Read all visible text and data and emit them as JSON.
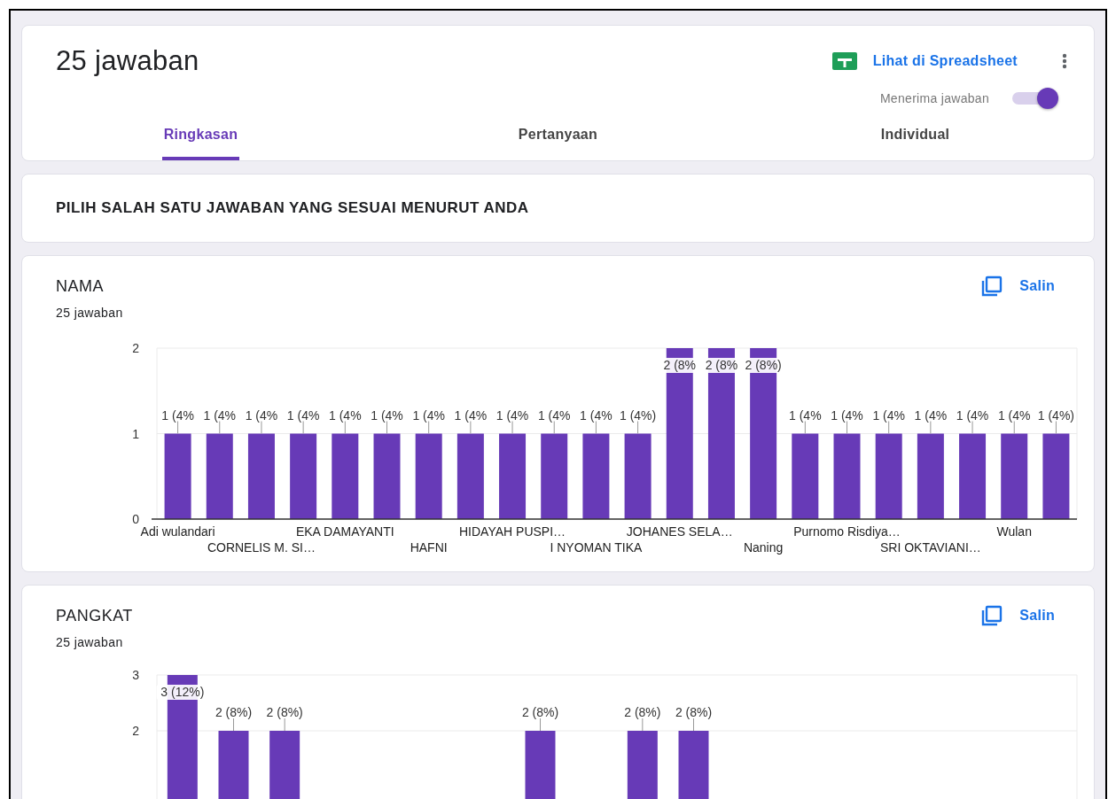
{
  "header": {
    "title": "25 jawaban",
    "spreadsheet_link": "Lihat di Spreadsheet",
    "accepting": {
      "label": "Menerima jawaban",
      "on": true
    }
  },
  "tabs": [
    {
      "label": "Ringkasan",
      "selected": true
    },
    {
      "label": "Pertanyaan",
      "selected": false
    },
    {
      "label": "Individual",
      "selected": false
    }
  ],
  "section": {
    "title": "PILIH SALAH SATU JAWABAN YANG SESUAI MENURUT ANDA"
  },
  "questions": [
    {
      "title": "NAMA",
      "count": "25 jawaban",
      "copy_label": "Salin",
      "chart_data": {
        "type": "bar",
        "categories": [
          "Adi wulandari",
          null,
          "CORNELIS M. SI…",
          null,
          "EKA DAMAYANTI",
          null,
          "HAFNI",
          null,
          "HIDAYAH PUSPI…",
          null,
          "I NYOMAN TIKA",
          null,
          "JOHANES SELA…",
          null,
          "Naning",
          null,
          "Purnomo Risdiya…",
          null,
          "SRI OKTAVIANI…",
          null,
          "Wulan",
          null
        ],
        "values": [
          1,
          1,
          1,
          1,
          1,
          1,
          1,
          1,
          1,
          1,
          1,
          1,
          2,
          2,
          2,
          1,
          1,
          1,
          1,
          1,
          1,
          1
        ],
        "value_labels": [
          "1 (4%",
          "1 (4%",
          "1 (4%",
          "1 (4%",
          "1 (4%",
          "1 (4%",
          "1 (4%",
          "1 (4%",
          "1 (4%",
          "1 (4%",
          "1 (4%",
          "1 (4%)",
          "2 (8%",
          "2 (8%",
          "2 (8%)",
          "1 (4%",
          "1 (4%",
          "1 (4%",
          "1 (4%",
          "1 (4%",
          "1 (4%",
          "1 (4%)"
        ],
        "ylim": [
          0,
          2
        ],
        "yticks": [
          0,
          1,
          2
        ],
        "color": "#673ab7"
      }
    },
    {
      "title": "PANGKAT",
      "count": "25 jawaban",
      "copy_label": "Salin",
      "chart_data": {
        "type": "bar",
        "values": [
          3,
          2,
          2,
          null,
          null,
          null,
          null,
          2,
          null,
          2,
          2,
          null,
          null,
          null,
          null,
          null,
          null,
          null
        ],
        "value_labels": [
          "3 (12%)",
          "2 (8%)",
          "2 (8%)",
          null,
          null,
          null,
          null,
          "2 (8%)",
          null,
          "2 (8%)",
          "2 (8%)",
          null,
          null,
          null,
          null,
          null,
          null,
          null
        ],
        "ylim": [
          0,
          3
        ],
        "yticks": [
          2,
          3
        ],
        "color": "#673ab7"
      }
    }
  ]
}
